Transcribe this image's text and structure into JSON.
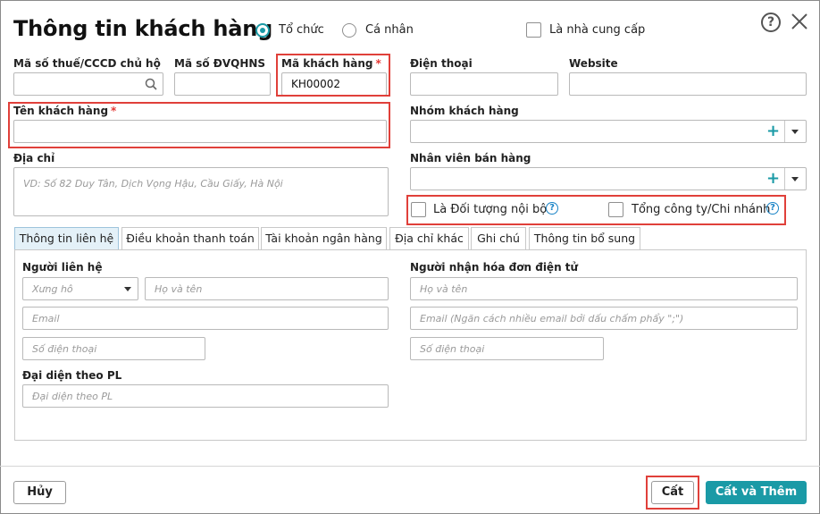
{
  "dialog": {
    "title": "Thông tin khách hàng",
    "type_options": [
      "Tổ chức",
      "Cá nhân"
    ],
    "type_selected": "Tổ chức",
    "supplier_label": "Là nhà cung cấp"
  },
  "fields": {
    "tax_code_label": "Mã số thuế/CCCD chủ hộ",
    "budget_code_label": "Mã số ĐVQHNS",
    "customer_code_label": "Mã khách hàng",
    "customer_code_value": "KH00002",
    "phone_label": "Điện thoại",
    "website_label": "Website",
    "customer_name_label": "Tên khách hàng",
    "customer_group_label": "Nhóm khách hàng",
    "address_label": "Địa chỉ",
    "address_placeholder": "VD: Số 82 Duy Tân, Dịch Vọng Hậu, Cầu Giấy, Hà Nội",
    "sales_staff_label": "Nhân viên bán hàng",
    "internal_label": "Là Đối tượng nội bộ",
    "branch_label": "Tổng công ty/Chi nhánh",
    "required_mark": "*"
  },
  "tabs": [
    "Thông tin liên hệ",
    "Điều khoản thanh toán",
    "Tài khoản ngân hàng",
    "Địa chỉ khác",
    "Ghi chú",
    "Thông tin bổ sung"
  ],
  "contact": {
    "contact_person_label": "Người liên hệ",
    "salutation_placeholder": "Xưng hô",
    "fullname_placeholder": "Họ và tên",
    "email_placeholder": "Email",
    "phone_placeholder": "Số điện thoại",
    "legal_rep_label": "Đại diện theo PL",
    "legal_rep_placeholder": "Đại diện theo PL",
    "einvoice_label": "Người nhận hóa đơn điện tử",
    "einvoice_name_placeholder": "Họ và tên",
    "einvoice_email_placeholder": "Email (Ngăn cách nhiều email bởi dấu chấm phẩy \";\")",
    "einvoice_phone_placeholder": "Số điện thoại"
  },
  "footer": {
    "cancel_label": "Hủy",
    "save_label": "Cất",
    "save_add_label": "Cất và Thêm"
  },
  "colors": {
    "accent": "#1a9aa6",
    "highlight": "#e0403a",
    "required": "#e53935"
  }
}
